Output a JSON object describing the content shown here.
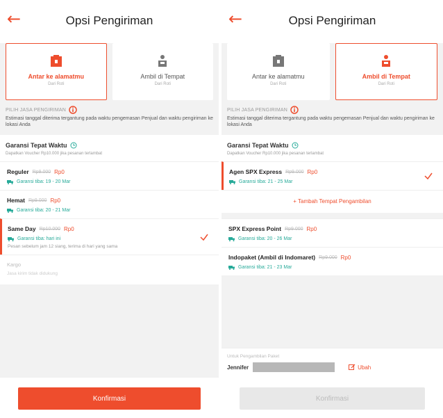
{
  "colors": {
    "accent": "#ee4d2d",
    "eta": "#26aa99"
  },
  "left": {
    "header": {
      "title": "Opsi Pengiriman"
    },
    "methods": [
      {
        "label": "Antar ke alamatmu",
        "sub": "Dari Roti"
      },
      {
        "label": "Ambil di Tempat",
        "sub": "Dari Roti"
      }
    ],
    "pilih_label": "PILIH JASA PENGIRIMAN",
    "estimate_text": "Estimasi tanggal diterima tergantung pada waktu pengemasan Penjual dan waktu pengiriman ke lokasi Anda",
    "garansi": {
      "title": "Garansi Tepat Waktu",
      "sub": "Dapatkan Voucher Rp10.000 jika pesanan terlambat"
    },
    "options": [
      {
        "name": "Reguler",
        "old_price": "Rp9.000",
        "price": "Rp0",
        "eta": "Garansi tiba: 19 - 20 Mar"
      },
      {
        "name": "Hemat",
        "old_price": "Rp9.000",
        "price": "Rp0",
        "eta": "Garansi tiba: 20 - 21 Mar"
      },
      {
        "name": "Same Day",
        "old_price": "Rp10.000",
        "price": "Rp0",
        "eta": "Garansi tiba: hari ini",
        "note": "Pesan sebelum jam 12 siang, terima di hari yang sama"
      }
    ],
    "kargo": {
      "name": "Kargo",
      "sub": "Jasa kirim tidak didukung"
    },
    "confirm_label": "Konfirmasi"
  },
  "right": {
    "header": {
      "title": "Opsi Pengiriman"
    },
    "methods": [
      {
        "label": "Antar ke alamatmu",
        "sub": "Dari Roti"
      },
      {
        "label": "Ambil di Tempat",
        "sub": "Dari Roti"
      }
    ],
    "pilih_label": "PILIH JASA PENGIRIMAN",
    "estimate_text": "Estimasi tanggal diterima tergantung pada waktu pengemasan Penjual dan waktu pengiriman ke lokasi Anda",
    "garansi": {
      "title": "Garansi Tepat Waktu",
      "sub": "Dapatkan Voucher Rp10.000 jika pesanan terlambat"
    },
    "agen": {
      "name": "Agen SPX Express",
      "old_price": "Rp9.000",
      "price": "Rp0",
      "eta": "Garansi tiba: 21 - 25 Mar"
    },
    "add_pickup_label": "+ Tambah Tempat Pengambilan",
    "options": [
      {
        "name": "SPX Express Point",
        "old_price": "Rp9.000",
        "price": "Rp0",
        "eta": "Garansi tiba: 20 - 26 Mar"
      },
      {
        "name": "Indopaket (Ambil di Indomaret)",
        "old_price": "Rp9.000",
        "price": "Rp0",
        "eta": "Garansi tiba: 21 - 23 Mar"
      }
    ],
    "pickup": {
      "label": "Untuk Pengambilan Paket",
      "name": "Jennifer",
      "edit_label": "Ubah"
    },
    "confirm_label": "Konfirmasi"
  }
}
